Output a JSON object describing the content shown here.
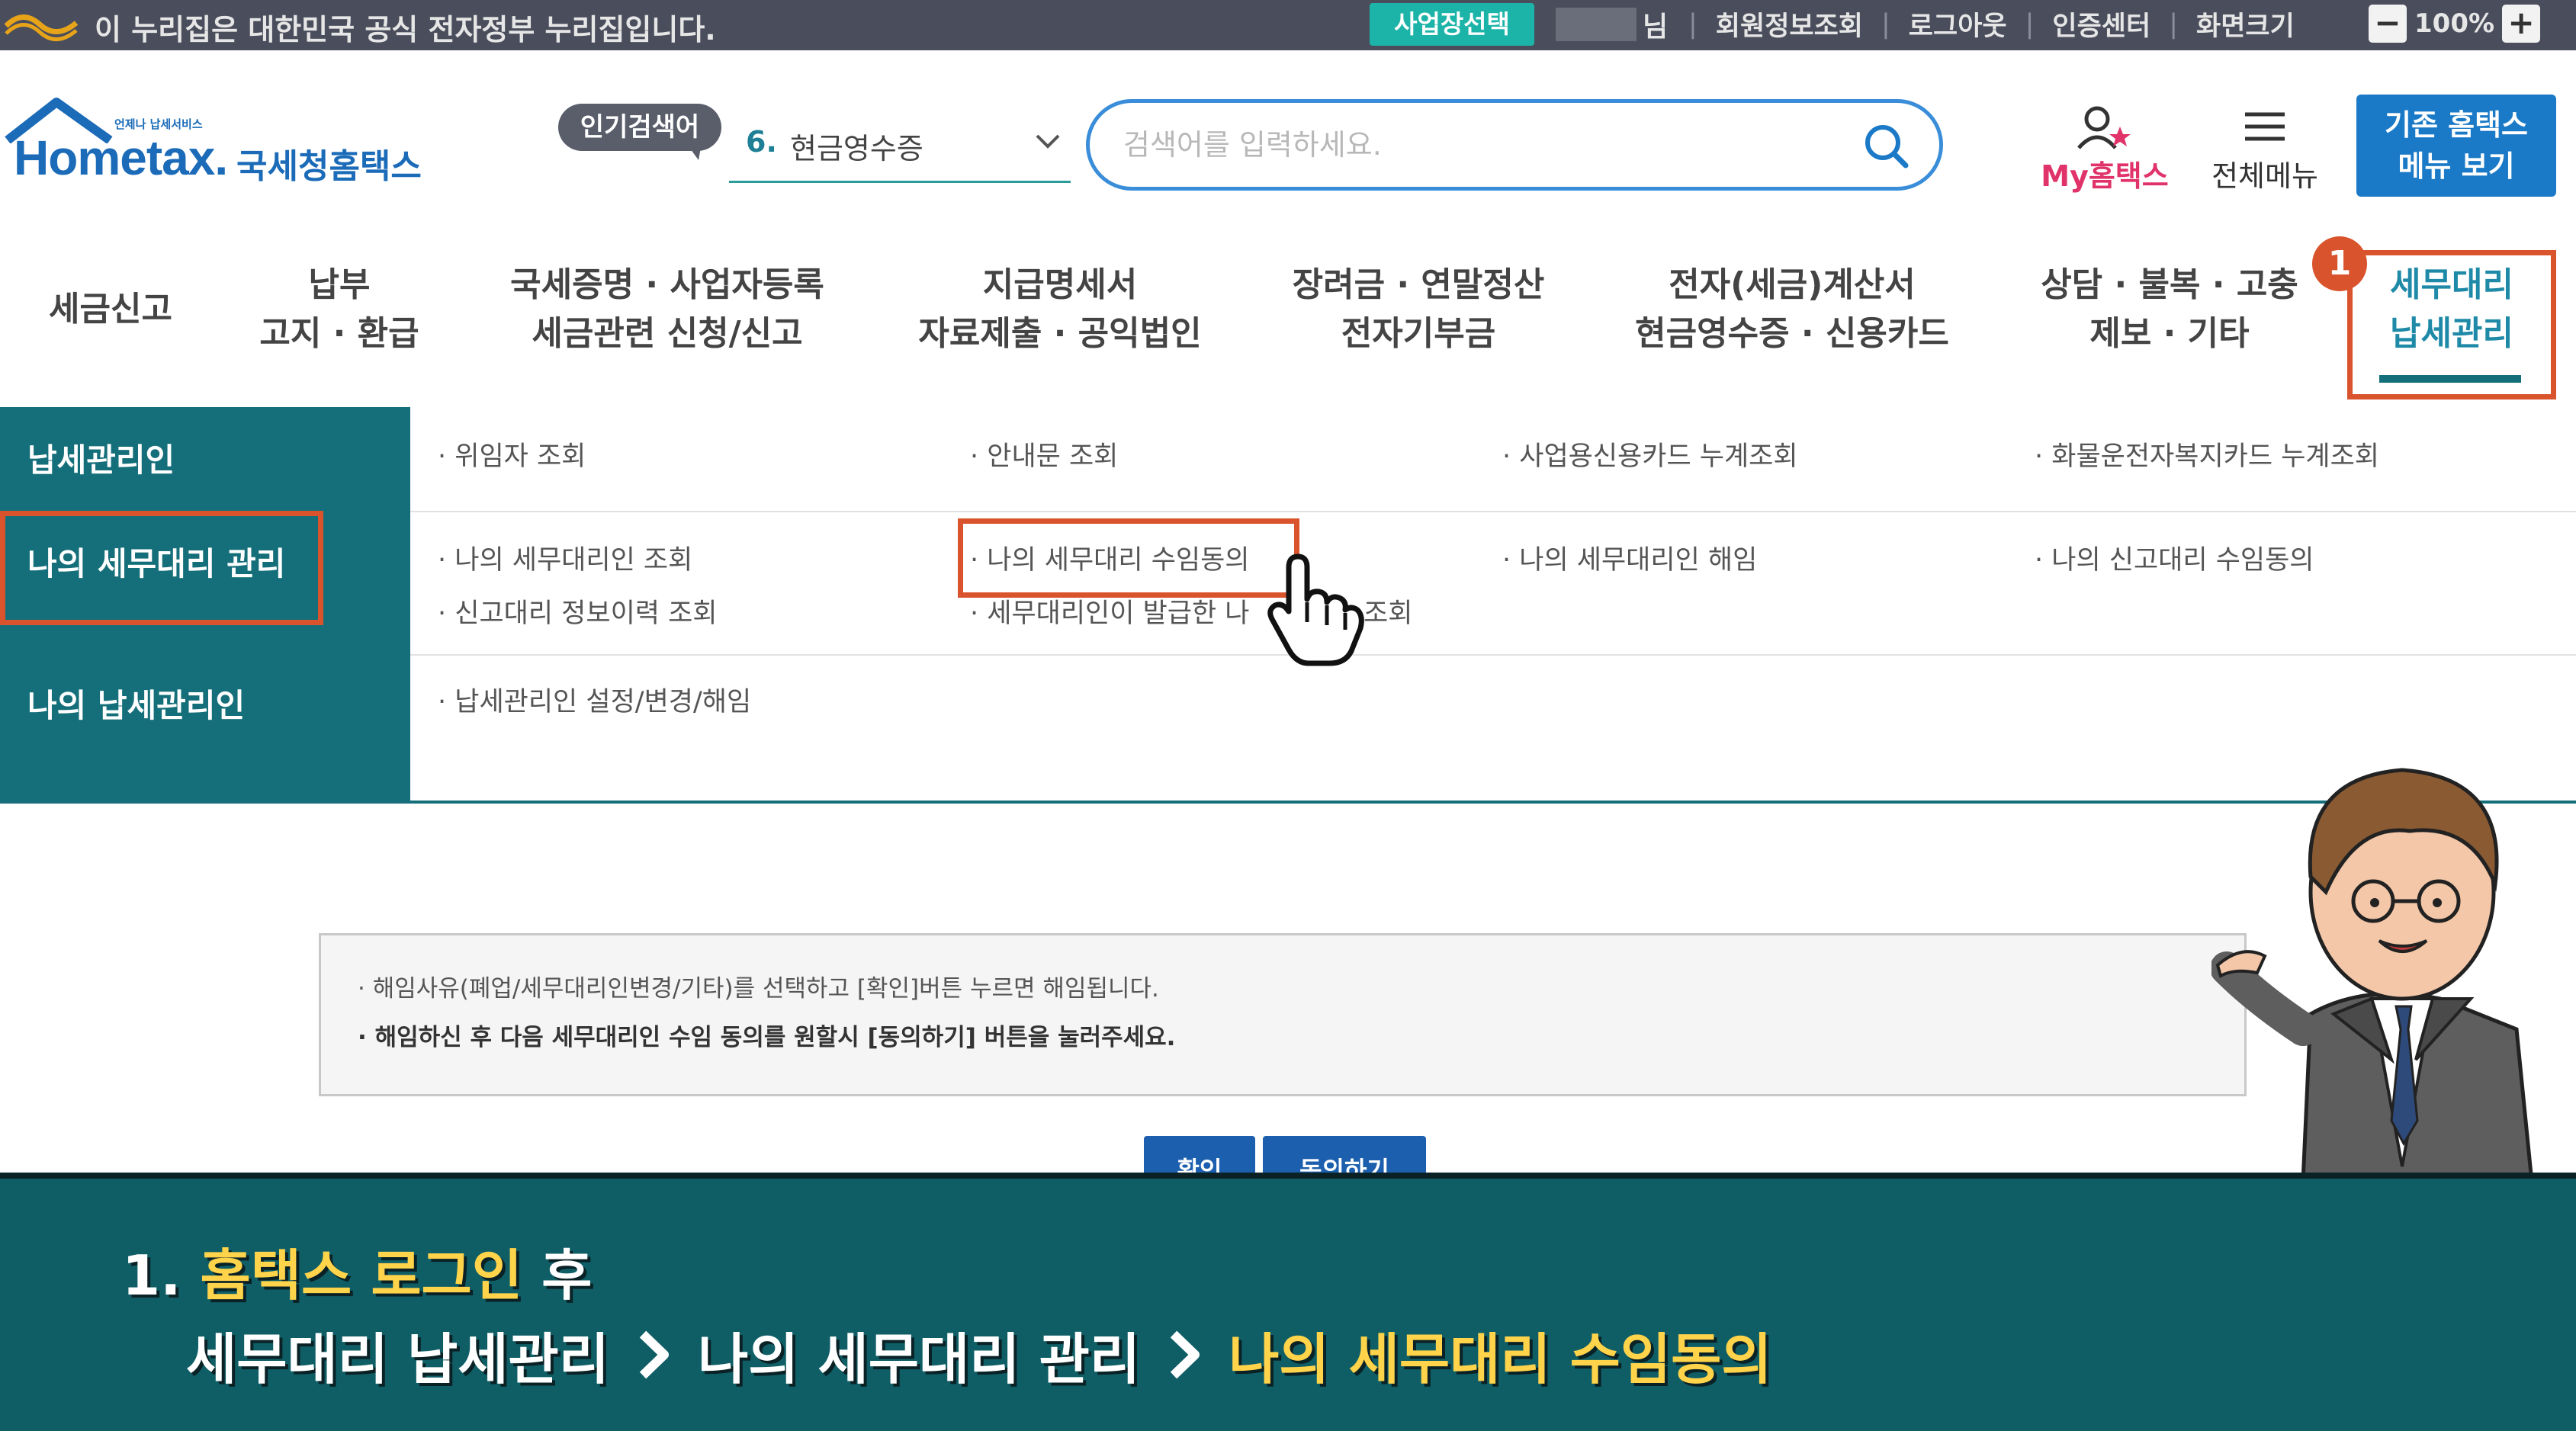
{
  "gov_banner": {
    "text": "이 누리집은 대한민국 공식 전자정부 누리집입니다.",
    "site_select": "사업장선택",
    "user_suffix": "님",
    "links": [
      "회원정보조회",
      "로그아웃",
      "인증센터",
      "화면크기"
    ],
    "zoom": "100%",
    "zoom_minus": "−",
    "zoom_plus": "+"
  },
  "header": {
    "logo_small": "언제나 납세서비스",
    "logo_text": "Hometax.",
    "logo_kor": "국세청홈택스",
    "popular_label": "인기검색어",
    "popular_num": "6.",
    "popular_word": "현금영수증",
    "search_placeholder": "검색어를 입력하세요.",
    "my_hometax": "My홈택스",
    "all_menu": "전체메뉴",
    "old_menu_1": "기존 홈택스",
    "old_menu_2": "메뉴 보기"
  },
  "nav": {
    "items": [
      {
        "line1": "세금신고",
        "line2": ""
      },
      {
        "line1": "납부",
        "line2": "고지 · 환급"
      },
      {
        "line1": "국세증명 · 사업자등록",
        "line2": "세금관련 신청/신고"
      },
      {
        "line1": "지급명세서",
        "line2": "자료제출 · 공익법인"
      },
      {
        "line1": "장려금 · 연말정산",
        "line2": "전자기부금"
      },
      {
        "line1": "전자(세금)계산서",
        "line2": "현금영수증 · 신용카드"
      },
      {
        "line1": "상담 · 불복 · 고충",
        "line2": "제보 · 기타"
      },
      {
        "line1": "세무대리",
        "line2": "납세관리"
      }
    ],
    "step_badge": "1"
  },
  "dropdown": {
    "side": [
      "납세관리인",
      "나의 세무대리 관리",
      "나의 납세관리인"
    ],
    "row1": [
      "· 위임자 조회",
      "· 안내문 조회",
      "· 사업용신용카드 누계조회",
      "· 화물운전자복지카드 누계조회"
    ],
    "row2": [
      "· 나의 세무대리인 조회",
      "· 나의 세무대리 수임동의",
      "· 나의 세무대리인 해임",
      "· 나의 신고대리 수임동의"
    ],
    "row2b": [
      "· 신고대리 정보이력 조회",
      "· 세무대리인이 발급한 나",
      "조회"
    ],
    "row3": [
      "· 납세관리인 설정/변경/해임"
    ]
  },
  "notice": {
    "line1": "· 해임사유(폐업/세무대리인변경/기타)를 선택하고 [확인]버튼 누르면 해임됩니다.",
    "line2": "· 해임하신 후 다음 세무대리인 수임 동의를 원할시 [동의하기] 버튼을 눌러주세요."
  },
  "buttons": {
    "confirm": "확인",
    "agree": "동의하기"
  },
  "caption": {
    "step": "1.",
    "hl1": "홈택스 로그인",
    "after": "후",
    "path1": "세무대리 납세관리",
    "path2": "나의 세무대리 관리",
    "path3": "나의 세무대리 수임동의"
  },
  "colors": {
    "teal": "#156f7a",
    "highlight_red": "#d9532c",
    "caption_yellow": "#ffd34a"
  }
}
